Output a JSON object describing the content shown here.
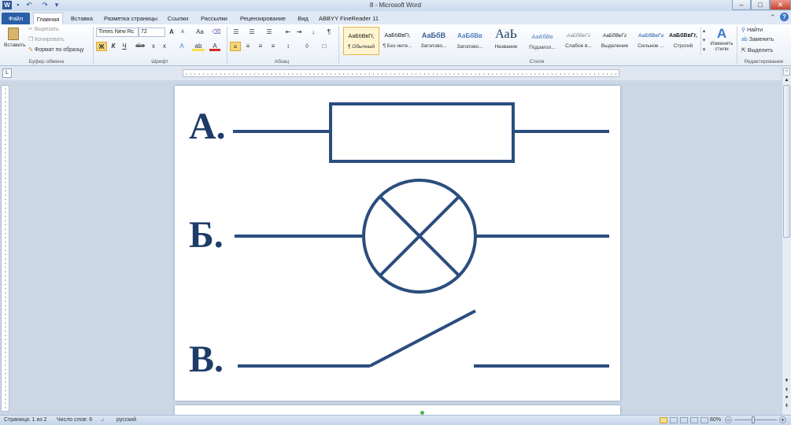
{
  "window": {
    "title": "8 - Microsoft Word"
  },
  "quick_access": {
    "undo": "↶",
    "redo": "↷",
    "customize": "▾"
  },
  "window_buttons": {
    "minimize": "–",
    "maximize": "□",
    "close": "✕"
  },
  "tabs": [
    {
      "label": "Файл"
    },
    {
      "label": "Главная"
    },
    {
      "label": "Вставка"
    },
    {
      "label": "Разметка страницы"
    },
    {
      "label": "Ссылки"
    },
    {
      "label": "Рассылки"
    },
    {
      "label": "Рецензирование"
    },
    {
      "label": "Вид"
    },
    {
      "label": "ABBYY FineReader 11"
    }
  ],
  "clipboard": {
    "paste": "Вставить",
    "cut": "Вырезать",
    "copy": "Копировать",
    "format_painter": "Формат по образцу",
    "group": "Буфер обмена"
  },
  "font": {
    "family": "Times New Rc",
    "size": "72",
    "grow": "A",
    "shrink": "A",
    "case": "Aa",
    "clear": "⌫",
    "bold": "Ж",
    "italic": "К",
    "underline": "Ч",
    "strike": "abe",
    "sub": "x",
    "sup": "x",
    "effects": "A",
    "highlight": "ab",
    "color": "A",
    "group": "Шрифт"
  },
  "paragraph": {
    "group": "Абзац",
    "bullets": "☰",
    "numbering": "☰",
    "multilevel": "☰",
    "dec_indent": "⇤",
    "inc_indent": "⇥",
    "sort": "↓",
    "pilcrow": "¶",
    "align_left": "≡",
    "center": "≡",
    "align_right": "≡",
    "justify": "≡",
    "spacing": "↕",
    "shading": "◊",
    "borders": "□"
  },
  "styles": {
    "group": "Стили",
    "items": [
      {
        "preview": "АаБбВвГг,",
        "name": "¶ Обычный"
      },
      {
        "preview": "АаБбВвГг,",
        "name": "¶ Без инте..."
      },
      {
        "preview": "АаБбВ",
        "name": "Заголово..."
      },
      {
        "preview": "АаБбВв",
        "name": "Заголово..."
      },
      {
        "preview": "АаЬ",
        "name": "Название"
      },
      {
        "preview": "АаБбВв",
        "name": "Подзагол..."
      },
      {
        "preview": "АаБбВеГг",
        "name": "Слабое в..."
      },
      {
        "preview": "АаБбВеГг",
        "name": "Выделение"
      },
      {
        "preview": "АаБбВеГг",
        "name": "Сильное ..."
      },
      {
        "preview": "АаБбВвГг,",
        "name": "Строгий"
      }
    ],
    "change": "Изменить стили"
  },
  "editing": {
    "find": "Найти",
    "replace": "Заменить",
    "select": "Выделить",
    "group": "Редактирование"
  },
  "document": {
    "labels": [
      "А.",
      "Б.",
      "В."
    ]
  },
  "status": {
    "page": "Страница: 1 из 2",
    "words": "Число слов: 6",
    "lang": "русский",
    "zoom": "80%"
  },
  "colors": {
    "diagram": "#2b4d7e",
    "letters": "#1f3c68"
  }
}
